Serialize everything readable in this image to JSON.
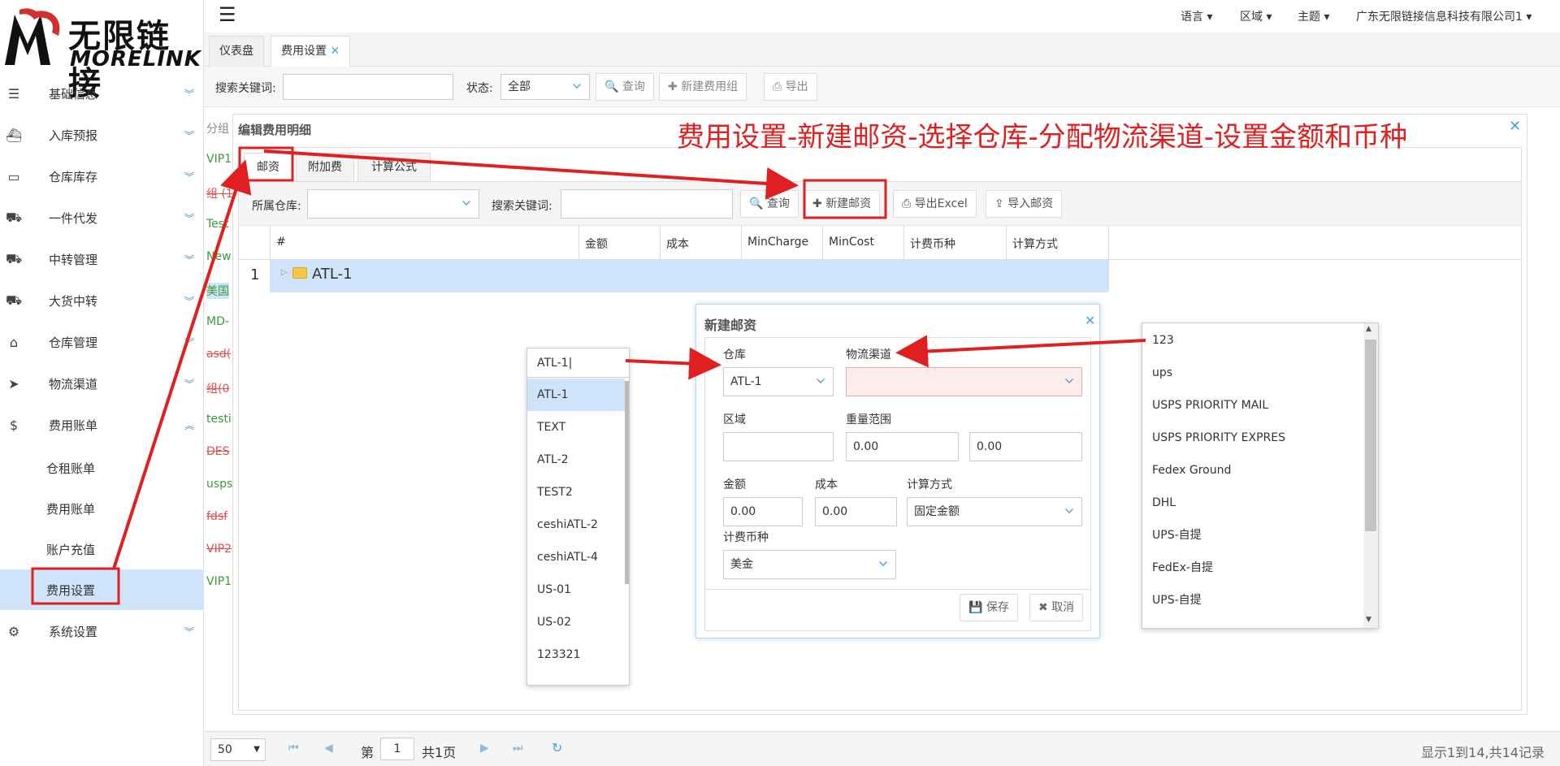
{
  "brand": {
    "cn": "无限链接",
    "en": "MORELINK"
  },
  "sidebar": {
    "items": [
      {
        "label": "基础信息",
        "icon": "list-icon"
      },
      {
        "label": "入库预报",
        "icon": "ship-icon"
      },
      {
        "label": "仓库库存",
        "icon": "inbox-icon"
      },
      {
        "label": "一件代发",
        "icon": "truck-icon"
      },
      {
        "label": "中转管理",
        "icon": "truck-icon"
      },
      {
        "label": "大货中转",
        "icon": "truck-icon"
      },
      {
        "label": "仓库管理",
        "icon": "home-icon"
      },
      {
        "label": "物流渠道",
        "icon": "cursor-icon"
      },
      {
        "label": "费用账单",
        "icon": "dollar-icon"
      }
    ],
    "subitems": [
      "仓租账单",
      "费用账单",
      "账户充值",
      "费用设置"
    ],
    "last": {
      "label": "系统设置",
      "icon": "gear-icon"
    }
  },
  "topbar": {
    "language": "语言",
    "region": "区域",
    "theme": "主题",
    "company": "广东无限链接信息科技有限公司1"
  },
  "tabs": [
    "仪表盘",
    "费用设置"
  ],
  "toolbar": {
    "keyword_label": "搜索关键词:",
    "status_label": "状态:",
    "status_value": "全部",
    "query": "查询",
    "new_group": "新建费用组",
    "export": "导出"
  },
  "bg_left": [
    "分组",
    "VIP1",
    "组 (1",
    "Test",
    "New",
    "美国",
    "MD-",
    "asd(",
    "组(0",
    "testi",
    "DES",
    "usps",
    "fdsf",
    "VIP2",
    "VIP1"
  ],
  "edit": {
    "title": "编辑费用明细",
    "tabs": [
      "邮资",
      "附加费",
      "计算公式"
    ],
    "warehouse_label": "所属仓库:",
    "keyword_label": "搜索关键词:",
    "query": "查询",
    "new_postage": "新建邮资",
    "export_excel": "导出Excel",
    "import_postage": "导入邮资",
    "columns": [
      "#",
      "金额",
      "成本",
      "MinCharge",
      "MinCost",
      "计费币种",
      "计算方式"
    ],
    "rows": [
      {
        "num": "1",
        "name": "ATL-1"
      }
    ]
  },
  "annotation": "费用设置-新建邮资-选择仓库-分配物流渠道-设置金额和币种",
  "dialog": {
    "title": "新建邮资",
    "warehouse_label": "仓库",
    "warehouse_value": "ATL-1",
    "channel_label": "物流渠道",
    "region_label": "区域",
    "weight_label": "重量范围",
    "weight_min": "0.00",
    "weight_max": "0.00",
    "amount_label": "金额",
    "amount": "0.00",
    "cost_label": "成本",
    "cost": "0.00",
    "calc_label": "计算方式",
    "calc_value": "固定金额",
    "currency_label": "计费币种",
    "currency_value": "美金",
    "save": "保存",
    "cancel": "取消"
  },
  "warehouse_dropdown": {
    "input": "ATL-1",
    "options": [
      "ATL-1",
      "TEXT",
      "ATL-2",
      "TEST2",
      "ceshiATL-2",
      "ceshiATL-4",
      "US-01",
      "US-02",
      "123321"
    ]
  },
  "channel_dropdown": {
    "options": [
      "123",
      "ups",
      "USPS PRIORITY MAIL",
      "USPS PRIORITY EXPRES",
      "Fedex Ground",
      "DHL",
      "UPS-自提",
      "FedEx-自提",
      "UPS-自提"
    ]
  },
  "pager": {
    "size": "50",
    "page_prefix": "第",
    "page": "1",
    "page_suffix": "共1页",
    "summary": "显示1到14,共14记录"
  },
  "colors": {
    "accent": "#4aa3df",
    "highlight": "#cfe4fa",
    "annotation": "#e02020"
  }
}
